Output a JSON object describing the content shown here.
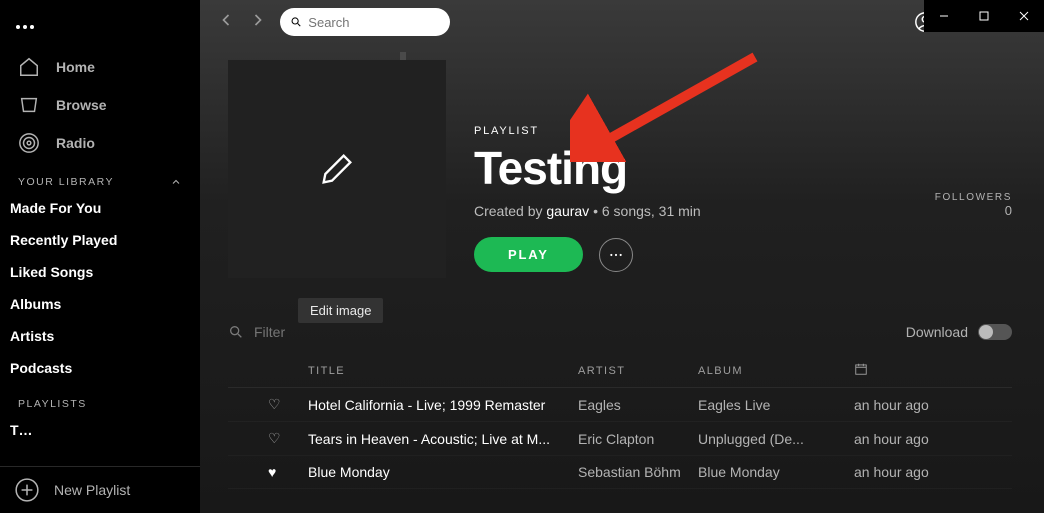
{
  "titlebar": {
    "minimize": "–",
    "maximize": "☐",
    "close": "✕"
  },
  "sidebar": {
    "home": "Home",
    "browse": "Browse",
    "radio": "Radio",
    "library_header": "YOUR LIBRARY",
    "library": [
      "Made For You",
      "Recently Played",
      "Liked Songs",
      "Albums",
      "Artists",
      "Podcasts"
    ],
    "playlists_header": "PLAYLISTS",
    "playlists": [
      "T…"
    ],
    "new_playlist": "New Playlist"
  },
  "search": {
    "placeholder": "Search"
  },
  "user": {
    "name": "gaurav"
  },
  "playlist": {
    "kind": "PLAYLIST",
    "title": "Testing",
    "created_by_label": "Created by ",
    "owner": "gaurav",
    "stats": " • 6 songs, 31 min",
    "play": "PLAY",
    "followers_label": "FOLLOWERS",
    "followers_count": "0",
    "edit_tooltip": "Edit image"
  },
  "filter": {
    "placeholder": "Filter",
    "download": "Download"
  },
  "columns": {
    "title": "TITLE",
    "artist": "ARTIST",
    "album": "ALBUM"
  },
  "tracks": [
    {
      "liked": false,
      "title": "Hotel California - Live; 1999 Remaster",
      "artist": "Eagles",
      "album": "Eagles Live",
      "when": "an hour ago"
    },
    {
      "liked": false,
      "title": "Tears in Heaven - Acoustic; Live at M...",
      "artist": "Eric Clapton",
      "album": "Unplugged (De...",
      "when": "an hour ago"
    },
    {
      "liked": true,
      "title": "Blue Monday",
      "artist": "Sebastian Böhm",
      "album": "Blue Monday",
      "when": "an hour ago"
    }
  ]
}
